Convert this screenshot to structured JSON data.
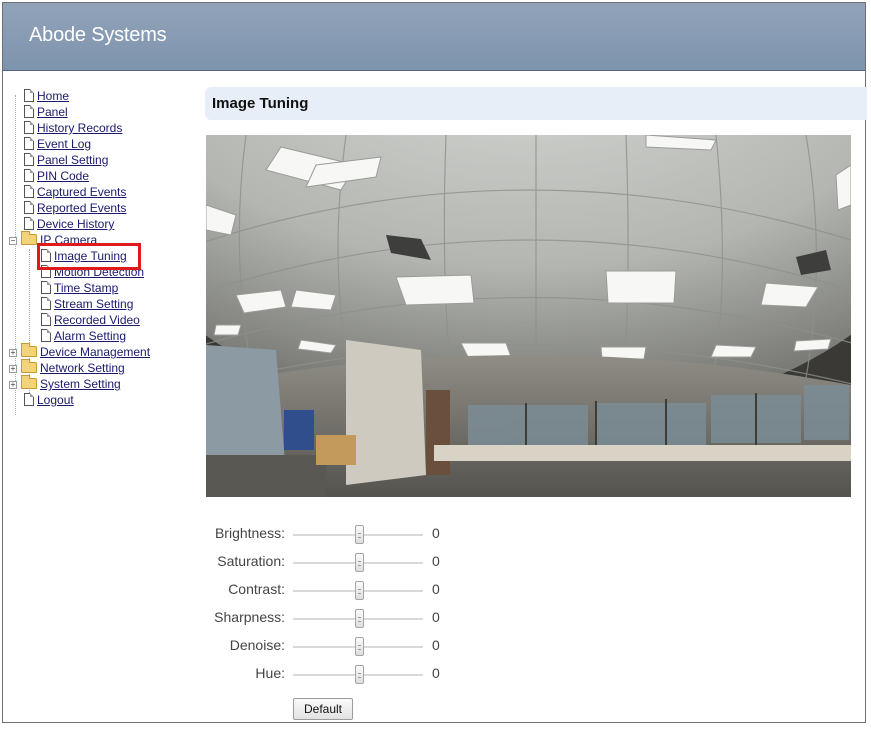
{
  "header": {
    "brand": "Abode Systems"
  },
  "sidebar": {
    "items": [
      {
        "label": "Home",
        "type": "file"
      },
      {
        "label": "Panel",
        "type": "file"
      },
      {
        "label": "History Records",
        "type": "file"
      },
      {
        "label": "Event Log",
        "type": "file"
      },
      {
        "label": "Panel Setting",
        "type": "file"
      },
      {
        "label": "PIN Code",
        "type": "file"
      },
      {
        "label": "Captured Events",
        "type": "file"
      },
      {
        "label": "Reported Events",
        "type": "file"
      },
      {
        "label": "Device History",
        "type": "file"
      },
      {
        "label": "IP Camera",
        "type": "folder",
        "expanded": true
      },
      {
        "label": "Image Tuning",
        "type": "file",
        "selected": true
      },
      {
        "label": "Motion Detection",
        "type": "file"
      },
      {
        "label": "Time Stamp",
        "type": "file"
      },
      {
        "label": "Stream Setting",
        "type": "file"
      },
      {
        "label": "Recorded Video",
        "type": "file"
      },
      {
        "label": "Alarm Setting",
        "type": "file"
      },
      {
        "label": "Device Management",
        "type": "folder",
        "expanded": false
      },
      {
        "label": "Network Setting",
        "type": "folder",
        "expanded": false
      },
      {
        "label": "System Setting",
        "type": "folder",
        "expanded": false
      },
      {
        "label": "Logout",
        "type": "file"
      }
    ]
  },
  "main": {
    "title": "Image Tuning",
    "camera_view": "fisheye-office-ceiling",
    "sliders": [
      {
        "label": "Brightness:",
        "value": "0"
      },
      {
        "label": "Saturation:",
        "value": "0"
      },
      {
        "label": "Contrast:",
        "value": "0"
      },
      {
        "label": "Sharpness:",
        "value": "0"
      },
      {
        "label": "Denoise:",
        "value": "0"
      },
      {
        "label": "Hue:",
        "value": "0"
      }
    ],
    "default_button": "Default"
  },
  "colors": {
    "header_bg": "#8597b0",
    "link": "#1a1a6e",
    "highlight": "#e01a1a",
    "title_bar_bg": "#e7eef7"
  }
}
